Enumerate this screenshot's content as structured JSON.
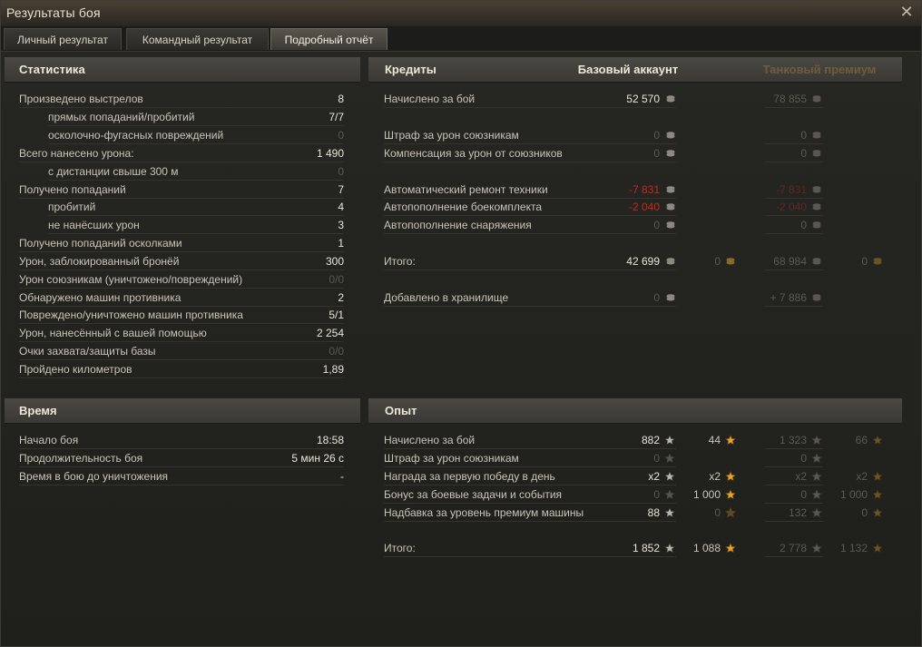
{
  "window": {
    "title": "Результаты боя",
    "close_icon": "close-icon"
  },
  "tabs": [
    {
      "label": "Личный результат"
    },
    {
      "label": "Командный результат"
    },
    {
      "label": "Подробный отчёт",
      "active": true
    }
  ],
  "statistics": {
    "title": "Статистика",
    "rows": [
      {
        "label": "Произведено выстрелов",
        "value": "8"
      },
      {
        "label": "прямых попаданий/пробитий",
        "value": "7/7",
        "indent": true
      },
      {
        "label": "осколочно-фугасных повреждений",
        "value": "0",
        "indent": true,
        "dim": true
      },
      {
        "label": "Всего нанесено урона:",
        "value": "1 490"
      },
      {
        "label": "с дистанции свыше 300 м",
        "value": "0",
        "indent": true,
        "dim": true
      },
      {
        "label": "Получено попаданий",
        "value": "7"
      },
      {
        "label": "пробитий",
        "value": "4",
        "indent": true
      },
      {
        "label": "не нанёсших урон",
        "value": "3",
        "indent": true
      },
      {
        "label": "Получено попаданий осколками",
        "value": "1"
      },
      {
        "label": "Урон, заблокированный бронёй",
        "value": "300"
      },
      {
        "label": "Урон союзникам (уничтожено/повреждений)",
        "value": "0/0",
        "dim": true
      },
      {
        "label": "Обнаружено машин противника",
        "value": "2"
      },
      {
        "label": "Повреждено/уничтожено машин противника",
        "value": "5/1"
      },
      {
        "label": "Урон, нанесённый с вашей помощью",
        "value": "2 254"
      },
      {
        "label": "Очки захвата/защиты базы",
        "value": "0/0",
        "dim": true
      },
      {
        "label": "Пройдено километров",
        "value": "1,89"
      }
    ]
  },
  "time": {
    "title": "Время",
    "rows": [
      {
        "label": "Начало боя",
        "value": "18:58"
      },
      {
        "label": "Продолжительность боя",
        "value": "5 мин 26 с"
      },
      {
        "label": "Время в бою до уничтожения",
        "value": "-"
      }
    ]
  },
  "credits": {
    "title": "Кредиты",
    "col_base": "Базовый аккаунт",
    "col_premium": "Танковый премиум",
    "rows": [
      {
        "label": "Начислено за бой",
        "base": "52 570",
        "premium": "78 855"
      },
      {
        "label": "Штраф за урон союзникам",
        "base": "0",
        "premium": "0",
        "dim": true
      },
      {
        "label": "Компенсация за урон от союзников",
        "base": "0",
        "premium": "0",
        "dim": true
      },
      {
        "label": "Автоматический ремонт техники",
        "base": "-7 831",
        "premium": "-7 831",
        "red": true
      },
      {
        "label": "Автопополнение боекомплекта",
        "base": "-2 040",
        "premium": "-2 040",
        "red": true
      },
      {
        "label": "Автопополнение снаряжения",
        "base": "0",
        "premium": "0",
        "dim": true
      },
      {
        "label": "Итого:",
        "base": "42 699",
        "base_gold": "0",
        "premium": "68 984",
        "premium_gold": "0"
      },
      {
        "label": "Добавлено в хранилище",
        "base": "0",
        "premium": "+ 7 886",
        "dim": true
      }
    ]
  },
  "experience": {
    "title": "Опыт",
    "rows": [
      {
        "label": "Начислено за бой",
        "xp": "882",
        "free": "44",
        "pxp": "1 323",
        "pfree": "66"
      },
      {
        "label": "Штраф за урон союзникам",
        "xp": "0",
        "pxp": "0",
        "dim": true
      },
      {
        "label": "Награда за первую победу в день",
        "xp": "x2",
        "free": "x2",
        "pxp": "x2",
        "pfree": "x2"
      },
      {
        "label": "Бонус за боевые задачи и события",
        "xp": "0",
        "free": "1 000",
        "pxp": "0",
        "pfree": "1 000",
        "xpdim": true
      },
      {
        "label": "Надбавка за уровень премиум машины",
        "xp": "88",
        "free": "0",
        "pxp": "132",
        "pfree": "0",
        "freedim": true
      },
      {
        "label": "Итого:",
        "xp": "1 852",
        "free": "1 088",
        "pxp": "2 778",
        "pfree": "1 132"
      }
    ]
  },
  "icons": {
    "credit": "credit-coin-icon",
    "gold": "gold-coin-icon",
    "xp": "xp-star-icon",
    "free_xp": "free-xp-star-icon"
  },
  "colors": {
    "negative": "#c42a1f",
    "gold_star": "#e8a12d",
    "premium_header": "#6f5d3e"
  }
}
